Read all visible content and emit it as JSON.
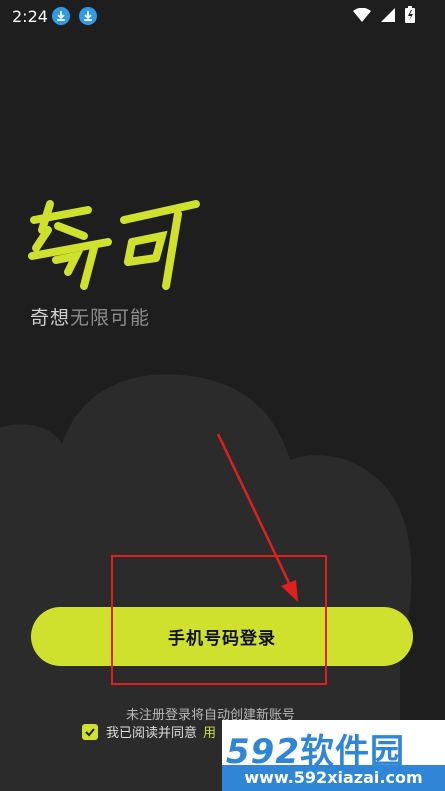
{
  "status_bar": {
    "time": "2:24"
  },
  "app": {
    "logo_text": "奇可",
    "slogan_part1": "奇想",
    "slogan_part2": "无限可能"
  },
  "login": {
    "phone_login_label": "手机号码登录",
    "hint": "未注册登录将自动创建新账号",
    "agree_text": "我已阅读并同意",
    "agree_link": "用",
    "agreed": true
  },
  "watermark": {
    "number": "592",
    "name": "软件园",
    "url": "www.592xiazai.com"
  },
  "colors": {
    "background": "#1e1e1e",
    "accent": "#cfe12c",
    "annotation": "#e02020"
  }
}
